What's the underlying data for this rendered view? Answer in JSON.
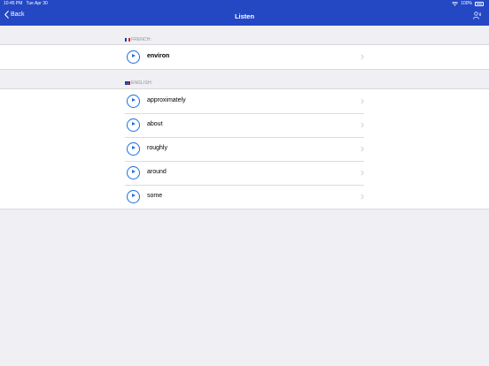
{
  "status": {
    "time": "10:45 PM",
    "date": "Tue Apr 30",
    "battery": "100%"
  },
  "nav": {
    "back_label": "Back",
    "title": "Listen"
  },
  "colors": {
    "nav_bg": "#2447c4",
    "accent": "#1d6ee0",
    "page_bg": "#efeff4"
  },
  "french": {
    "header": "FRENCH:",
    "items": [
      {
        "label": "environ"
      }
    ]
  },
  "english": {
    "header": "ENGLISH:",
    "items": [
      {
        "label": "approximately"
      },
      {
        "label": "about"
      },
      {
        "label": "roughly"
      },
      {
        "label": "around"
      },
      {
        "label": "some"
      }
    ]
  }
}
